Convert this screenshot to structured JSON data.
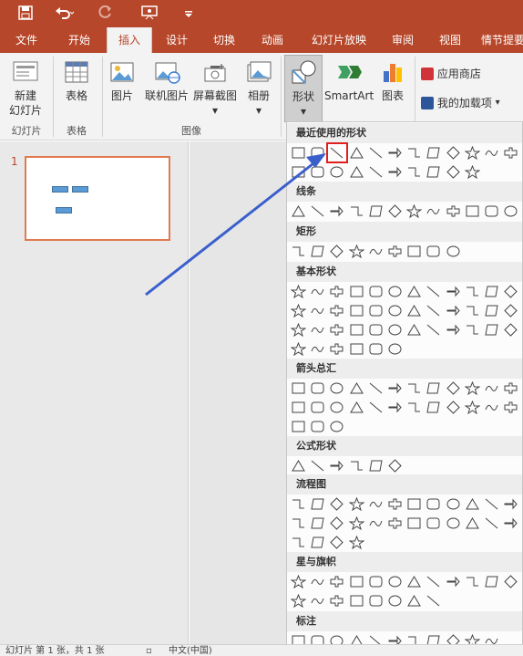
{
  "app": {
    "accent_color": "#b7472a",
    "quick_access": [
      "save-icon",
      "undo-icon",
      "redo-icon",
      "present-icon",
      "customize-icon"
    ]
  },
  "menu": {
    "tabs": [
      "文件",
      "开始",
      "插入",
      "设计",
      "切换",
      "动画",
      "幻灯片放映",
      "审阅",
      "视图",
      "情节提要"
    ],
    "active": "插入"
  },
  "ribbon": {
    "new_slide_line1": "新建",
    "new_slide_line2": "幻灯片",
    "table": "表格",
    "picture": "图片",
    "online_picture": "联机图片",
    "screenshot": "屏幕截图",
    "album": "相册",
    "shapes": "形状",
    "smartart": "SmartArt",
    "chart": "图表",
    "store": "应用商店",
    "my_addins": "我的加载项",
    "group_slides": "幻灯片",
    "group_table": "表格",
    "group_images": "图像"
  },
  "slides": {
    "current_number": "1"
  },
  "dropdown": {
    "sections": [
      {
        "title": "最近使用的形状",
        "count": 22
      },
      {
        "title": "线条",
        "count": 12
      },
      {
        "title": "矩形",
        "count": 9
      },
      {
        "title": "基本形状",
        "count": 42
      },
      {
        "title": "箭头总汇",
        "count": 27
      },
      {
        "title": "公式形状",
        "count": 6
      },
      {
        "title": "流程图",
        "count": 28
      },
      {
        "title": "星与旗帜",
        "count": 20
      },
      {
        "title": "标注",
        "count": 11
      }
    ],
    "selected_shape": "line-shape"
  },
  "statusbar": {
    "slide_info": "幻灯片 第 1 张，共 1 张",
    "language": "中文(中国)"
  }
}
